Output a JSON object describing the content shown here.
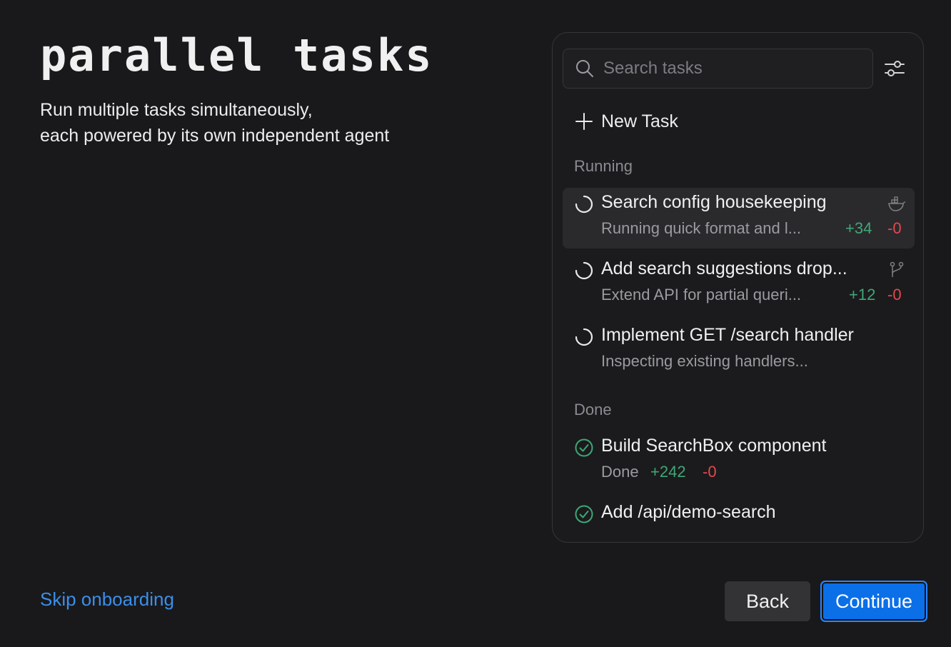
{
  "hero": {
    "title": "parallel tasks",
    "subtitle_line1": "Run multiple tasks simultaneously,",
    "subtitle_line2": "each powered by its own independent agent"
  },
  "panel": {
    "search": {
      "placeholder": "Search tasks",
      "value": ""
    },
    "new_task_label": "New Task",
    "sections": {
      "running": "Running",
      "done": "Done"
    },
    "running_tasks": [
      {
        "title": "Search config housekeeping",
        "subtitle": "Running quick format and l...",
        "additions": "+34",
        "deletions": "-0",
        "kind_icon": "docker-icon",
        "active": true
      },
      {
        "title": "Add search suggestions drop...",
        "subtitle": "Extend API for partial queri...",
        "additions": "+12",
        "deletions": "-0",
        "kind_icon": "branch-icon",
        "active": false
      },
      {
        "title": "Implement GET /search handler",
        "subtitle": "Inspecting existing handlers...",
        "active": false
      }
    ],
    "done_tasks": [
      {
        "title": "Build SearchBox component",
        "subtitle": "Done",
        "additions": "+242",
        "deletions": "-0"
      },
      {
        "title": "Add /api/demo-search"
      }
    ]
  },
  "footer": {
    "skip_label": "Skip onboarding",
    "back_label": "Back",
    "continue_label": "Continue"
  },
  "colors": {
    "background": "#19191b",
    "accent": "#0b6fe8",
    "link": "#3b8eea",
    "additions": "#3fa776",
    "deletions": "#e5484d",
    "done_check": "#3fa776"
  }
}
